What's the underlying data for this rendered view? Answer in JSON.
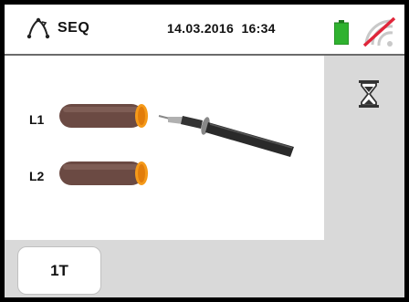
{
  "header": {
    "mode_icon": "phase-sequence-icon",
    "mode_label": "SEQ",
    "datetime": "14.03.2016  16:34",
    "battery_icon": "battery-icon",
    "battery_color": "#2fb22f",
    "wifi_icon": "wifi-disabled-icon",
    "wifi_slash_color": "#e0263a"
  },
  "main": {
    "wires": [
      {
        "label": "L1"
      },
      {
        "label": "L2"
      }
    ],
    "probe_icon": "test-probe-icon",
    "status_icon": "hourglass-icon"
  },
  "softkeys": [
    {
      "label": "1T"
    }
  ]
}
